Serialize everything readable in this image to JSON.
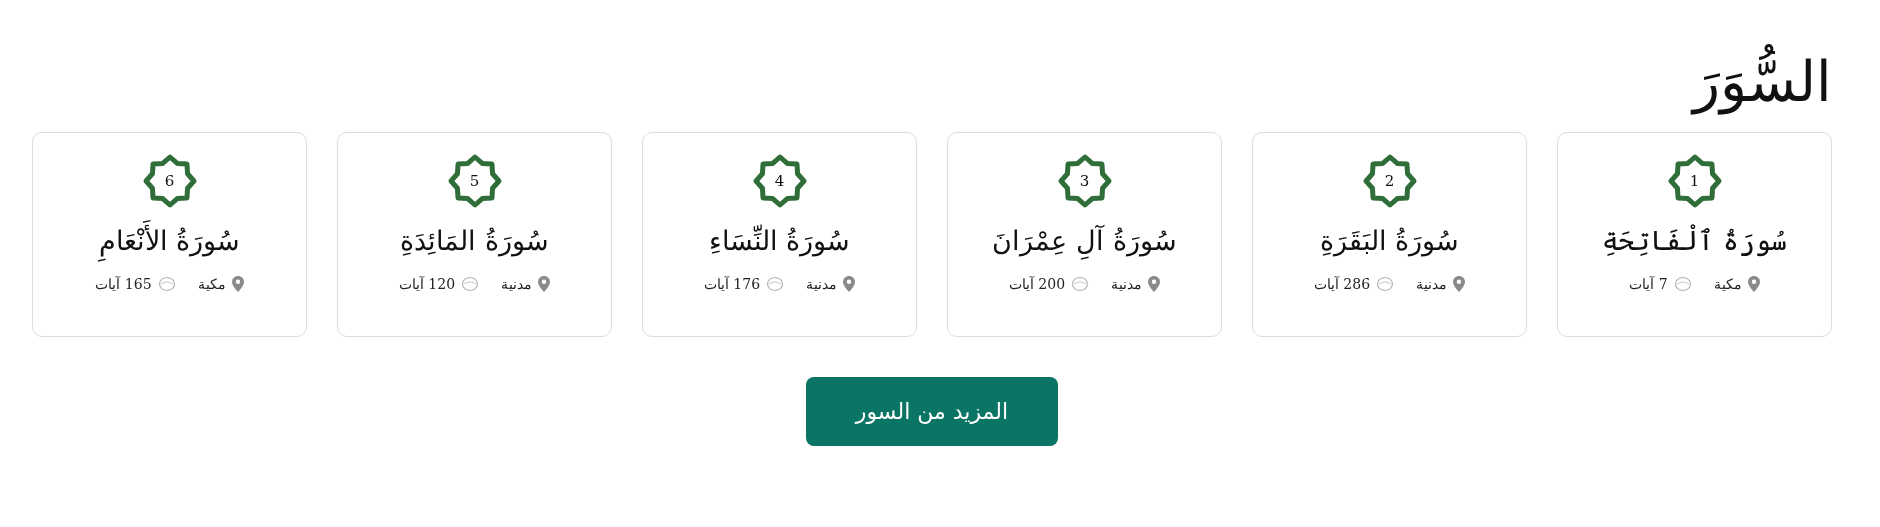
{
  "title": "السُّوَرَ",
  "surahs": [
    {
      "number": "1",
      "name": "سُورَةُ ٱلْفَاتِحَةِ",
      "type": "مكية",
      "ayat": "7 آيات"
    },
    {
      "number": "2",
      "name": "سُورَةُ البَقَرَةِ",
      "type": "مدنية",
      "ayat": "286 آيات"
    },
    {
      "number": "3",
      "name": "سُورَةُ آلِ عِمْرَانَ",
      "type": "مدنية",
      "ayat": "200 آيات"
    },
    {
      "number": "4",
      "name": "سُورَةُ النِّسَاءِ",
      "type": "مدنية",
      "ayat": "176 آيات"
    },
    {
      "number": "5",
      "name": "سُورَةُ المَائِدَةِ",
      "type": "مدنية",
      "ayat": "120 آيات"
    },
    {
      "number": "6",
      "name": "سُورَةُ الأَنْعَامِ",
      "type": "مكية",
      "ayat": "165 آيات"
    }
  ],
  "more_button": "المزيد من السور"
}
